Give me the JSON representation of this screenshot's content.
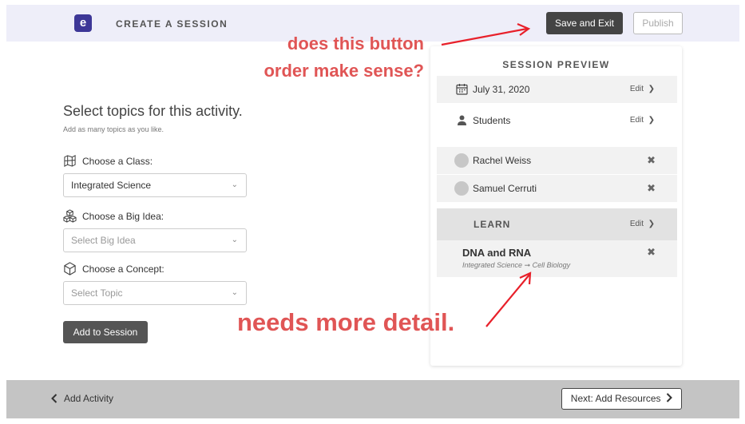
{
  "header": {
    "logo_letter": "e",
    "title": "CREATE A SESSION",
    "save_exit_label": "Save and Exit",
    "publish_label": "Publish"
  },
  "form": {
    "title": "Select topics for this activity.",
    "subtitle": "Add as many topics as you like.",
    "class_label": "Choose a Class:",
    "class_value": "Integrated Science",
    "bigidea_label": "Choose a Big Idea:",
    "bigidea_placeholder": "Select Big Idea",
    "concept_label": "Choose a Concept:",
    "concept_placeholder": "Select Topic",
    "add_label": "Add to Session"
  },
  "preview": {
    "title": "SESSION PREVIEW",
    "date": "July 31, 2020",
    "students_label": "Students",
    "edit_label": "Edit",
    "students": [
      "Rachel Weiss",
      "Samuel Cerruti"
    ],
    "learn_label": "LEARN",
    "topic_title": "DNA and RNA",
    "topic_class": "Integrated Science",
    "topic_arrow": "➞",
    "topic_sub": "Cell Biology",
    "remove_glyph": "✖",
    "chevron_glyph": "❯"
  },
  "footer": {
    "back_label": "Add Activity",
    "next_label": "Next: Add Resources"
  },
  "annotations": {
    "note1_line1": "does this button",
    "note1_line2": "order make sense?",
    "note2": "needs more detail."
  },
  "colors": {
    "header_bg": "#eeeef9",
    "brand": "#3d3797",
    "annotation": "#e05555",
    "footer_bg": "#c4c4c4"
  }
}
